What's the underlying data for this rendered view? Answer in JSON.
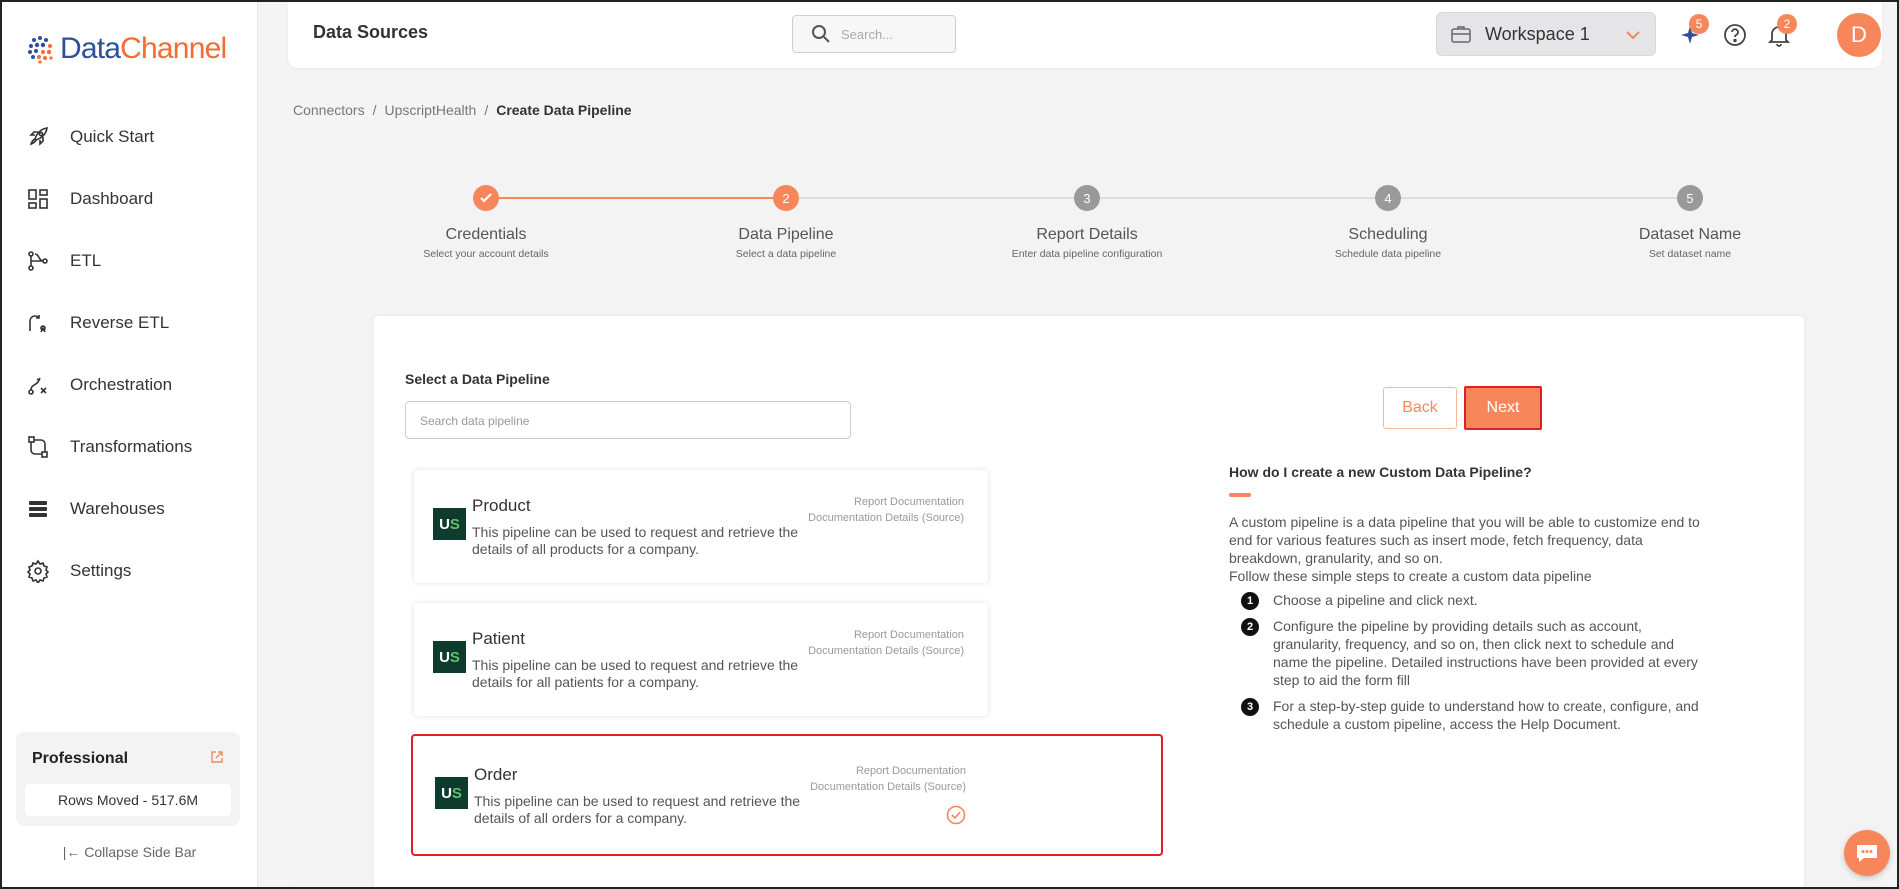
{
  "brand": {
    "name_part1": "Data",
    "name_part2": "Channel"
  },
  "sidebar": {
    "items": [
      {
        "label": "Quick Start",
        "icon": "rocket-icon"
      },
      {
        "label": "Dashboard",
        "icon": "dashboard-icon"
      },
      {
        "label": "ETL",
        "icon": "etl-icon"
      },
      {
        "label": "Reverse ETL",
        "icon": "reverse-etl-icon"
      },
      {
        "label": "Orchestration",
        "icon": "orchestration-icon"
      },
      {
        "label": "Transformations",
        "icon": "transformations-icon"
      },
      {
        "label": "Warehouses",
        "icon": "warehouses-icon"
      },
      {
        "label": "Settings",
        "icon": "gear-icon"
      }
    ],
    "plan": {
      "title": "Professional",
      "rows_moved": "Rows Moved - 517.6M"
    },
    "collapse_label": "Collapse Side Bar"
  },
  "header": {
    "title": "Data Sources",
    "search_placeholder": "Search...",
    "workspace": "Workspace 1",
    "ai_badge": "5",
    "notifications_badge": "2",
    "avatar_initial": "D"
  },
  "breadcrumb": [
    "Connectors",
    "UpscriptHealth",
    "Create Data Pipeline"
  ],
  "stepper": [
    {
      "num": "",
      "title": "Credentials",
      "subtitle": "Select your account details"
    },
    {
      "num": "2",
      "title": "Data Pipeline",
      "subtitle": "Select a data pipeline"
    },
    {
      "num": "3",
      "title": "Report Details",
      "subtitle": "Enter data pipeline configuration"
    },
    {
      "num": "4",
      "title": "Scheduling",
      "subtitle": "Schedule data pipeline"
    },
    {
      "num": "5",
      "title": "Dataset Name",
      "subtitle": "Set dataset name"
    }
  ],
  "pipelines": {
    "label": "Select a Data Pipeline",
    "search_placeholder": "Search data pipeline",
    "back": "Back",
    "next": "Next",
    "items": [
      {
        "logo": "U",
        "logo2": "S",
        "title": "Product",
        "desc": "This pipeline can be used to request and retrieve the details of all products for a company.",
        "link1": "Report Documentation",
        "link2": "Documentation Details (Source)"
      },
      {
        "logo": "U",
        "logo2": "S",
        "title": "Patient",
        "desc": "This pipeline can be used to request and retrieve the details for all patients for a company.",
        "link1": "Report Documentation",
        "link2": "Documentation Details (Source)"
      },
      {
        "logo": "U",
        "logo2": "S",
        "title": "Order",
        "desc": "This pipeline can be used to request and retrieve the details of all orders for a company.",
        "link1": "Report Documentation",
        "link2": "Documentation Details (Source)"
      }
    ]
  },
  "help": {
    "title": "How do I create a new Custom Data Pipeline?",
    "intro": "A custom pipeline is a data pipeline that you will be able to customize end to end for various features such as insert mode, fetch frequency, data breakdown, granularity, and so on.",
    "intro2": "Follow these simple steps to create a custom data pipeline",
    "steps": [
      {
        "n": "1",
        "text": "Choose a pipeline and click next."
      },
      {
        "n": "2",
        "text": "Configure the pipeline by providing details such as account, granularity, frequency, and so on, then click next to schedule and name the pipeline. Detailed instructions have been provided at every step to aid the form fill"
      },
      {
        "n": "3",
        "text": "For a step-by-step guide to understand how to create, configure, and schedule a custom pipeline, access the Help Document."
      }
    ]
  },
  "colors": {
    "accent": "#f7875a",
    "brand_blue": "#2d4f9e",
    "selected_border": "#e02020"
  }
}
